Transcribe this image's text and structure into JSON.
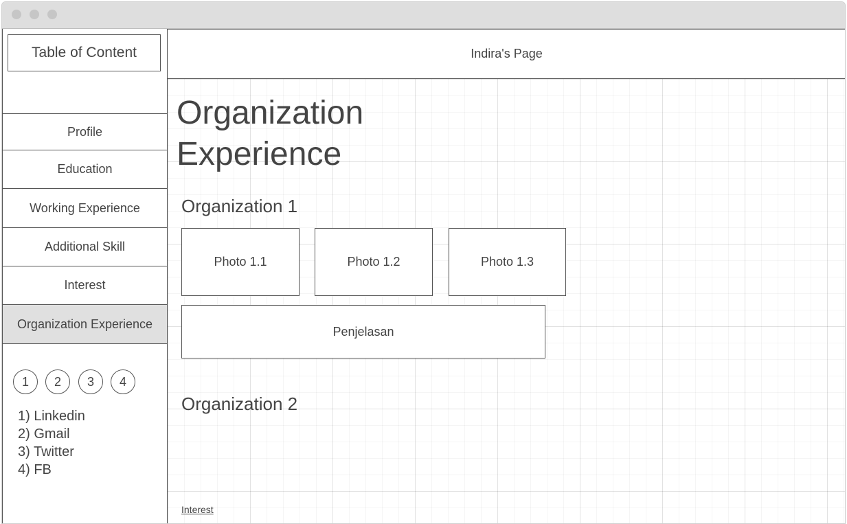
{
  "header": {
    "title": "Indira's Page"
  },
  "sidebar": {
    "toc_title": "Table of Content",
    "items": [
      {
        "label": "Profile"
      },
      {
        "label": "Education"
      },
      {
        "label": "Working Experience"
      },
      {
        "label": "Additional Skill"
      },
      {
        "label": "Interest"
      },
      {
        "label": "Organization Experience",
        "active": true
      }
    ],
    "circles": [
      "1",
      "2",
      "3",
      "4"
    ],
    "links": [
      "1) Linkedin",
      "2) Gmail",
      "3) Twitter",
      "4) FB"
    ]
  },
  "main": {
    "title_line1": "Organization",
    "title_line2": "Experience",
    "org1_title": "Organization 1",
    "photos": [
      "Photo 1.1",
      "Photo 1.2",
      "Photo 1.3"
    ],
    "description": "Penjelasan",
    "org2_title": "Organization 2",
    "next_link": "Interest"
  },
  "colors": {
    "active_bg": "#e0e0e0",
    "border": "#555555",
    "grid": "#ebebeb",
    "titlebar": "#dedede"
  }
}
